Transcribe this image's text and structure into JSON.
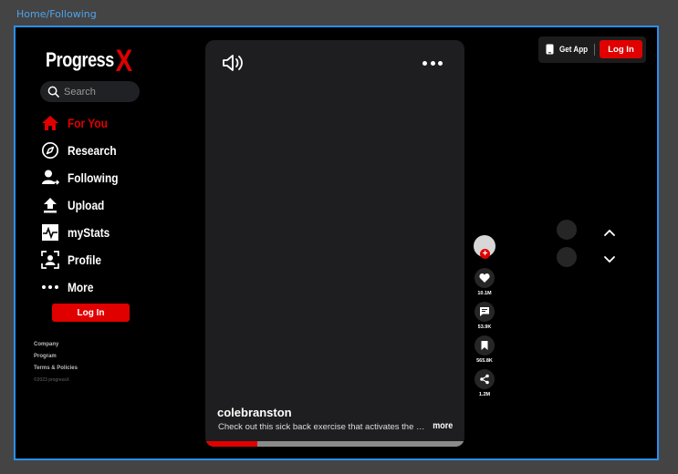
{
  "breadcrumb": "Home/Following",
  "brand": {
    "name": "Progress",
    "mark": "X",
    "accent": "#e00000"
  },
  "search": {
    "placeholder": "Search"
  },
  "sidebar": {
    "items": [
      {
        "label": "For You",
        "icon": "home-icon",
        "active": true
      },
      {
        "label": "Research",
        "icon": "compass-icon"
      },
      {
        "label": "Following",
        "icon": "user-following-icon"
      },
      {
        "label": "Upload",
        "icon": "upload-icon"
      },
      {
        "label": "myStats",
        "icon": "pulse-icon"
      },
      {
        "label": "Profile",
        "icon": "profile-scan-icon"
      },
      {
        "label": "More",
        "icon": "more-dots-icon"
      }
    ],
    "login_label": "Log In",
    "footer": {
      "links": [
        "Company",
        "Program",
        "Terms & Policies"
      ],
      "copyright": "©2023 progressX"
    }
  },
  "video": {
    "author": "colebranston",
    "caption": "Check out this sick back exercise that activates the entire posterior chain",
    "more_label": "more",
    "progress": 0.2
  },
  "actions": {
    "likes": "10.1M",
    "comments": "53.9K",
    "saves": "565.8K",
    "shares": "1.2M"
  },
  "topbar": {
    "get_app_label": "Get App",
    "login_label": "Log In"
  },
  "colors": {
    "frame_border": "#2b8ff0",
    "background": "#000000",
    "accent": "#e00000"
  }
}
